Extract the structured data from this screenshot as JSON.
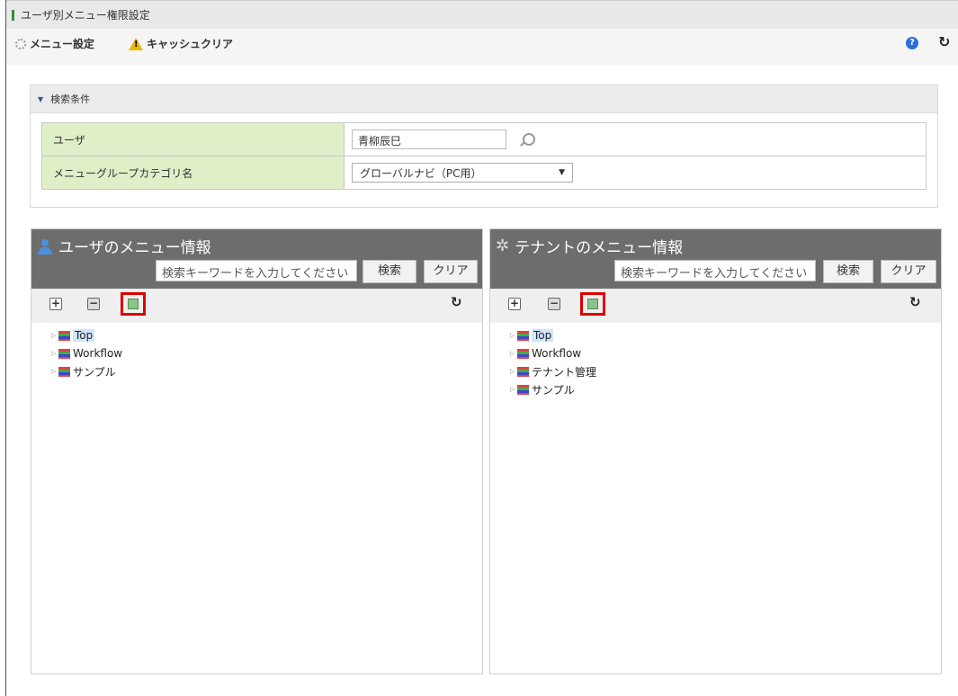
{
  "title": "ユーザ別メニュー権限設定",
  "toolbar": {
    "menu_settings": "メニュー設定",
    "cache_clear": "キャッシュクリア",
    "help_icon": "?"
  },
  "search_conditions": {
    "header": "検索条件",
    "user_label": "ユーザ",
    "user_value": "青柳辰巳",
    "category_label": "メニューグループカテゴリ名",
    "category_value": "グローバルナビ（PC用）"
  },
  "user_panel": {
    "title": "ユーザのメニュー情報",
    "search_placeholder": "検索キーワードを入力してください",
    "search_button": "検索",
    "clear_button": "クリア",
    "tree": [
      "Top",
      "Workflow",
      "サンプル"
    ]
  },
  "tenant_panel": {
    "title": "テナントのメニュー情報",
    "search_placeholder": "検索キーワードを入力してください",
    "search_button": "検索",
    "clear_button": "クリア",
    "tree": [
      "Top",
      "Workflow",
      "テナント管理",
      "サンプル"
    ]
  },
  "colors": {
    "header_bg": "#6d6d6d",
    "label_bg": "#dfefc8",
    "highlight": "#dd0000"
  }
}
